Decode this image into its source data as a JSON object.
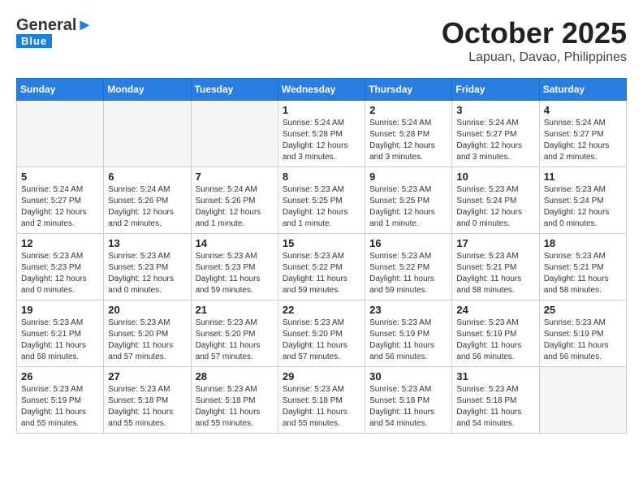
{
  "header": {
    "logo_general": "General",
    "logo_blue": "Blue",
    "month": "October 2025",
    "location": "Lapuan, Davao, Philippines"
  },
  "weekdays": [
    "Sunday",
    "Monday",
    "Tuesday",
    "Wednesday",
    "Thursday",
    "Friday",
    "Saturday"
  ],
  "weeks": [
    [
      {
        "day": "",
        "info": ""
      },
      {
        "day": "",
        "info": ""
      },
      {
        "day": "",
        "info": ""
      },
      {
        "day": "1",
        "info": "Sunrise: 5:24 AM\nSunset: 5:28 PM\nDaylight: 12 hours\nand 3 minutes."
      },
      {
        "day": "2",
        "info": "Sunrise: 5:24 AM\nSunset: 5:28 PM\nDaylight: 12 hours\nand 3 minutes."
      },
      {
        "day": "3",
        "info": "Sunrise: 5:24 AM\nSunset: 5:27 PM\nDaylight: 12 hours\nand 3 minutes."
      },
      {
        "day": "4",
        "info": "Sunrise: 5:24 AM\nSunset: 5:27 PM\nDaylight: 12 hours\nand 2 minutes."
      }
    ],
    [
      {
        "day": "5",
        "info": "Sunrise: 5:24 AM\nSunset: 5:27 PM\nDaylight: 12 hours\nand 2 minutes."
      },
      {
        "day": "6",
        "info": "Sunrise: 5:24 AM\nSunset: 5:26 PM\nDaylight: 12 hours\nand 2 minutes."
      },
      {
        "day": "7",
        "info": "Sunrise: 5:24 AM\nSunset: 5:26 PM\nDaylight: 12 hours\nand 1 minute."
      },
      {
        "day": "8",
        "info": "Sunrise: 5:23 AM\nSunset: 5:25 PM\nDaylight: 12 hours\nand 1 minute."
      },
      {
        "day": "9",
        "info": "Sunrise: 5:23 AM\nSunset: 5:25 PM\nDaylight: 12 hours\nand 1 minute."
      },
      {
        "day": "10",
        "info": "Sunrise: 5:23 AM\nSunset: 5:24 PM\nDaylight: 12 hours\nand 0 minutes."
      },
      {
        "day": "11",
        "info": "Sunrise: 5:23 AM\nSunset: 5:24 PM\nDaylight: 12 hours\nand 0 minutes."
      }
    ],
    [
      {
        "day": "12",
        "info": "Sunrise: 5:23 AM\nSunset: 5:23 PM\nDaylight: 12 hours\nand 0 minutes."
      },
      {
        "day": "13",
        "info": "Sunrise: 5:23 AM\nSunset: 5:23 PM\nDaylight: 12 hours\nand 0 minutes."
      },
      {
        "day": "14",
        "info": "Sunrise: 5:23 AM\nSunset: 5:23 PM\nDaylight: 11 hours\nand 59 minutes."
      },
      {
        "day": "15",
        "info": "Sunrise: 5:23 AM\nSunset: 5:22 PM\nDaylight: 11 hours\nand 59 minutes."
      },
      {
        "day": "16",
        "info": "Sunrise: 5:23 AM\nSunset: 5:22 PM\nDaylight: 11 hours\nand 59 minutes."
      },
      {
        "day": "17",
        "info": "Sunrise: 5:23 AM\nSunset: 5:21 PM\nDaylight: 11 hours\nand 58 minutes."
      },
      {
        "day": "18",
        "info": "Sunrise: 5:23 AM\nSunset: 5:21 PM\nDaylight: 11 hours\nand 58 minutes."
      }
    ],
    [
      {
        "day": "19",
        "info": "Sunrise: 5:23 AM\nSunset: 5:21 PM\nDaylight: 11 hours\nand 58 minutes."
      },
      {
        "day": "20",
        "info": "Sunrise: 5:23 AM\nSunset: 5:20 PM\nDaylight: 11 hours\nand 57 minutes."
      },
      {
        "day": "21",
        "info": "Sunrise: 5:23 AM\nSunset: 5:20 PM\nDaylight: 11 hours\nand 57 minutes."
      },
      {
        "day": "22",
        "info": "Sunrise: 5:23 AM\nSunset: 5:20 PM\nDaylight: 11 hours\nand 57 minutes."
      },
      {
        "day": "23",
        "info": "Sunrise: 5:23 AM\nSunset: 5:19 PM\nDaylight: 11 hours\nand 56 minutes."
      },
      {
        "day": "24",
        "info": "Sunrise: 5:23 AM\nSunset: 5:19 PM\nDaylight: 11 hours\nand 56 minutes."
      },
      {
        "day": "25",
        "info": "Sunrise: 5:23 AM\nSunset: 5:19 PM\nDaylight: 11 hours\nand 56 minutes."
      }
    ],
    [
      {
        "day": "26",
        "info": "Sunrise: 5:23 AM\nSunset: 5:19 PM\nDaylight: 11 hours\nand 55 minutes."
      },
      {
        "day": "27",
        "info": "Sunrise: 5:23 AM\nSunset: 5:18 PM\nDaylight: 11 hours\nand 55 minutes."
      },
      {
        "day": "28",
        "info": "Sunrise: 5:23 AM\nSunset: 5:18 PM\nDaylight: 11 hours\nand 55 minutes."
      },
      {
        "day": "29",
        "info": "Sunrise: 5:23 AM\nSunset: 5:18 PM\nDaylight: 11 hours\nand 55 minutes."
      },
      {
        "day": "30",
        "info": "Sunrise: 5:23 AM\nSunset: 5:18 PM\nDaylight: 11 hours\nand 54 minutes."
      },
      {
        "day": "31",
        "info": "Sunrise: 5:23 AM\nSunset: 5:18 PM\nDaylight: 11 hours\nand 54 minutes."
      },
      {
        "day": "",
        "info": ""
      }
    ]
  ]
}
